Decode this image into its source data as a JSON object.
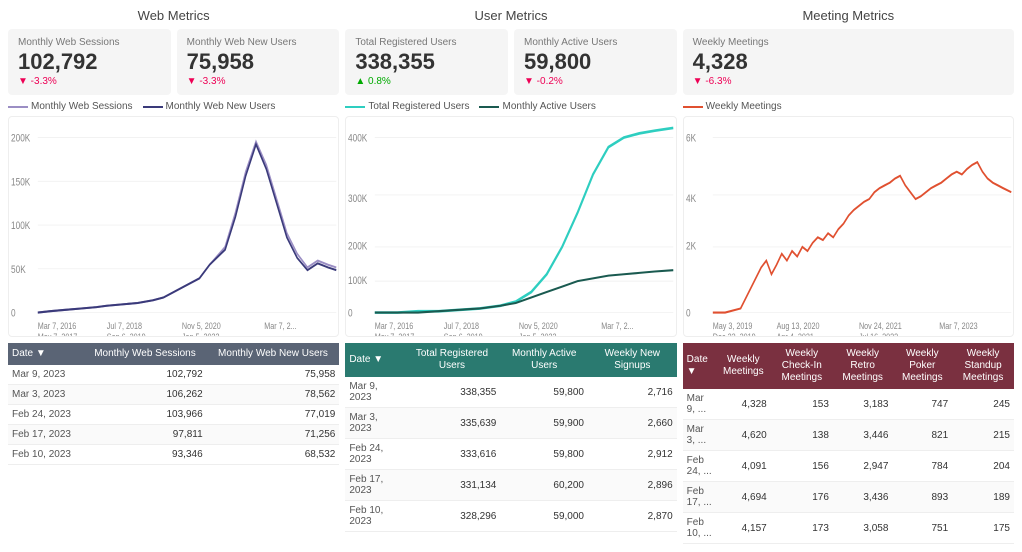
{
  "webMetrics": {
    "title": "Web Metrics",
    "cards": [
      {
        "label": "Monthly Web Sessions",
        "value": "102,792",
        "change": "▼ -3.3%",
        "changeType": "negative"
      },
      {
        "label": "Monthly Web New Users",
        "value": "75,958",
        "change": "▼ -3.3%",
        "changeType": "negative"
      }
    ],
    "legend": [
      {
        "label": "Monthly Web Sessions",
        "color": "#9b8ec4",
        "style": "solid"
      },
      {
        "label": "Monthly Web New Users",
        "color": "#3a3a7a",
        "style": "solid"
      }
    ]
  },
  "userMetrics": {
    "title": "User Metrics",
    "cards": [
      {
        "label": "Total Registered Users",
        "value": "338,355",
        "change": "▲ 0.8%",
        "changeType": "positive"
      },
      {
        "label": "Monthly Active Users",
        "value": "59,800",
        "change": "▼ -0.2%",
        "changeType": "negative"
      }
    ],
    "legend": [
      {
        "label": "Total Registered Users",
        "color": "#2ecec0",
        "style": "solid"
      },
      {
        "label": "Monthly Active Users",
        "color": "#1a5a50",
        "style": "solid"
      }
    ]
  },
  "meetingMetrics": {
    "title": "Meeting Metrics",
    "cards": [
      {
        "label": "Weekly Meetings",
        "value": "4,328",
        "change": "▼ -6.3%",
        "changeType": "negative"
      }
    ],
    "legend": [
      {
        "label": "Weekly Meetings",
        "color": "#e05030",
        "style": "solid"
      }
    ]
  },
  "webTable": {
    "headers": [
      "Date ▼",
      "Monthly Web Sessions",
      "Monthly Web New Users"
    ],
    "rows": [
      [
        "Mar 9, 2023",
        "102,792",
        "75,958"
      ],
      [
        "Mar 3, 2023",
        "106,262",
        "78,562"
      ],
      [
        "Feb 24, 2023",
        "103,966",
        "77,019"
      ],
      [
        "Feb 17, 2023",
        "97,811",
        "71,256"
      ],
      [
        "Feb 10, 2023",
        "93,346",
        "68,532"
      ]
    ]
  },
  "userTable": {
    "headers": [
      "Date ▼",
      "Total Registered Users",
      "Monthly Active Users",
      "Weekly New Signups"
    ],
    "rows": [
      [
        "Mar 9, 2023",
        "338,355",
        "59,800",
        "2,716"
      ],
      [
        "Mar 3, 2023",
        "335,639",
        "59,900",
        "2,660"
      ],
      [
        "Feb 24, 2023",
        "333,616",
        "59,800",
        "2,912"
      ],
      [
        "Feb 17, 2023",
        "331,134",
        "60,200",
        "2,896"
      ],
      [
        "Feb 10, 2023",
        "328,296",
        "59,000",
        "2,870"
      ]
    ]
  },
  "meetingTable": {
    "headers": [
      "Date ▼",
      "Weekly Meetings",
      "Weekly Check-In Meetings",
      "Weekly Retro Meetings",
      "Weekly Poker Meetings",
      "Weekly Standup Meetings"
    ],
    "rows": [
      [
        "Mar 9, ...",
        "4,328",
        "153",
        "3,183",
        "747",
        "245"
      ],
      [
        "Mar 3, ...",
        "4,620",
        "138",
        "3,446",
        "821",
        "215"
      ],
      [
        "Feb 24, ...",
        "4,091",
        "156",
        "2,947",
        "784",
        "204"
      ],
      [
        "Feb 17, ...",
        "4,694",
        "176",
        "3,436",
        "893",
        "189"
      ],
      [
        "Feb 10, ...",
        "4,157",
        "173",
        "3,058",
        "751",
        "175"
      ]
    ]
  }
}
